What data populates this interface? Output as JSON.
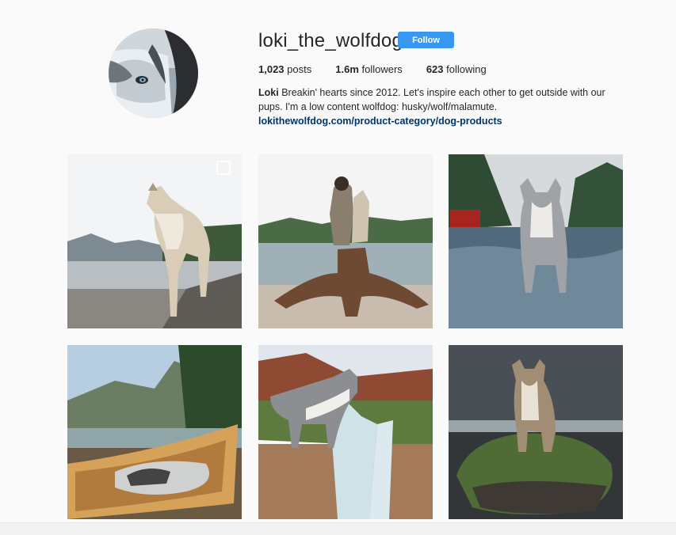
{
  "profile": {
    "username": "loki_the_wolfdog",
    "follow_label": "Follow",
    "stats": {
      "posts_count": "1,023",
      "posts_label": "posts",
      "followers_count": "1.6m",
      "followers_label": "followers",
      "following_count": "623",
      "following_label": "following"
    },
    "bio": {
      "name": "Loki",
      "text": "Breakin' hearts since 2012. Let's inspire each other to get outside with our pups. I'm a low content wolfdog: husky/wolf/malamute.",
      "link": "lokithewolfdog.com/product-category/dog-products"
    }
  },
  "colors": {
    "accent": "#3897f0",
    "link": "#003569",
    "text": "#262626"
  }
}
